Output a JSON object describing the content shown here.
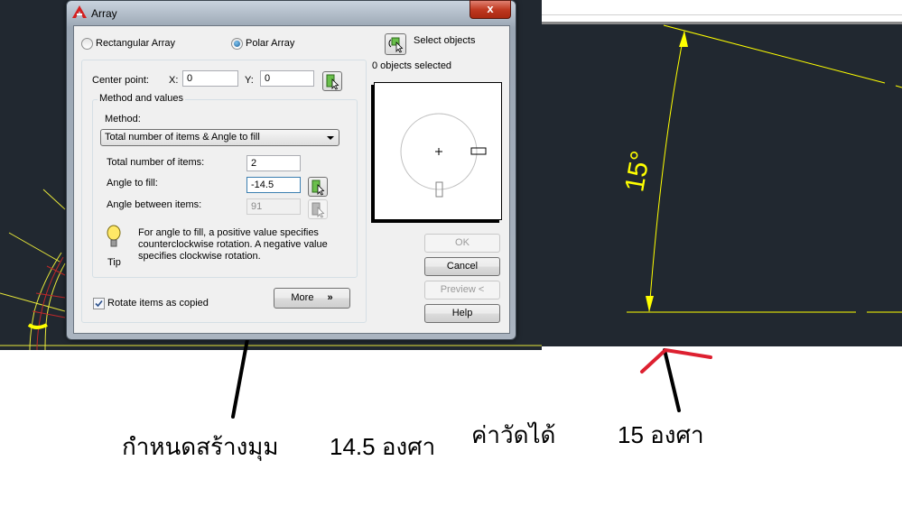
{
  "dialog": {
    "title": "Array",
    "close_label": "x",
    "array_type": {
      "rectangular_label": "Rectangular Array",
      "polar_label": "Polar Array",
      "selected": "Polar Array"
    },
    "center_point": {
      "label": "Center point:",
      "x_label": "X:",
      "x_value": "0",
      "y_label": "Y:",
      "y_value": "0"
    },
    "method_group_label": "Method and values",
    "method_label": "Method:",
    "method_value": "Total number of items & Angle to fill",
    "total_items_label": "Total number of items:",
    "total_items_value": "2",
    "angle_to_fill_label": "Angle to fill:",
    "angle_to_fill_value": "-14.5",
    "angle_between_label": "Angle between items:",
    "angle_between_value": "91",
    "tip_label": "Tip",
    "tip_text_1": "For angle to fill, a positive value specifies",
    "tip_text_2": "counterclockwise rotation.  A negative value",
    "tip_text_3": "specifies clockwise rotation.",
    "rotate_label": "Rotate items as copied",
    "rotate_checked": true,
    "more_label": "More",
    "select_objects_label": "Select objects",
    "objects_selected_label": "0 objects selected",
    "buttons": {
      "ok": "OK",
      "cancel": "Cancel",
      "preview": "Preview <",
      "help": "Help"
    }
  },
  "drawing": {
    "dimension_text": "15°",
    "colors": {
      "background": "#212830",
      "line": "#ffff00",
      "red": "#d42020"
    }
  },
  "annotations": {
    "define_angle": "กำหนดสร้างมุม",
    "angle_value": "14.5 องศา",
    "measured_label": "ค่าวัดได้",
    "measured_value": "15 องศา"
  }
}
